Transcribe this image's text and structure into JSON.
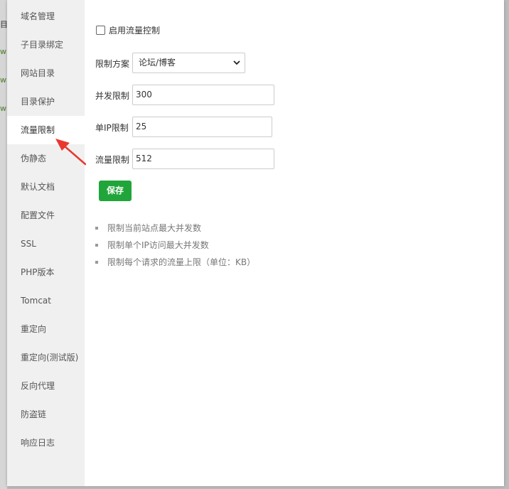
{
  "sidebar": {
    "items": [
      {
        "label": "域名管理"
      },
      {
        "label": "子目录绑定"
      },
      {
        "label": "网站目录"
      },
      {
        "label": "目录保护"
      },
      {
        "label": "流量限制",
        "active": true
      },
      {
        "label": "伪静态"
      },
      {
        "label": "默认文档"
      },
      {
        "label": "配置文件"
      },
      {
        "label": "SSL"
      },
      {
        "label": "PHP版本"
      },
      {
        "label": "Tomcat"
      },
      {
        "label": "重定向"
      },
      {
        "label": "重定向(测试版)"
      },
      {
        "label": "反向代理"
      },
      {
        "label": "防盗链"
      },
      {
        "label": "响应日志"
      }
    ]
  },
  "form": {
    "enable_label": "启用流量控制",
    "enable_checked": false,
    "scheme_label": "限制方案",
    "scheme_value": "论坛/博客",
    "concurrency_label": "并发限制",
    "concurrency_value": "300",
    "per_ip_label": "单IP限制",
    "per_ip_value": "25",
    "traffic_label": "流量限制",
    "traffic_value": "512",
    "save_label": "保存"
  },
  "tips": [
    "限制当前站点最大并发数",
    "限制单个IP访问最大并发数",
    "限制每个请求的流量上限（单位：KB）"
  ],
  "background": {
    "edge_fragments": [
      "目",
      "w",
      "w",
      "w"
    ]
  },
  "colors": {
    "accent_green": "#20a53a",
    "annotation_arrow": "#e8392f",
    "sidebar_bg": "#f0f0f0"
  }
}
